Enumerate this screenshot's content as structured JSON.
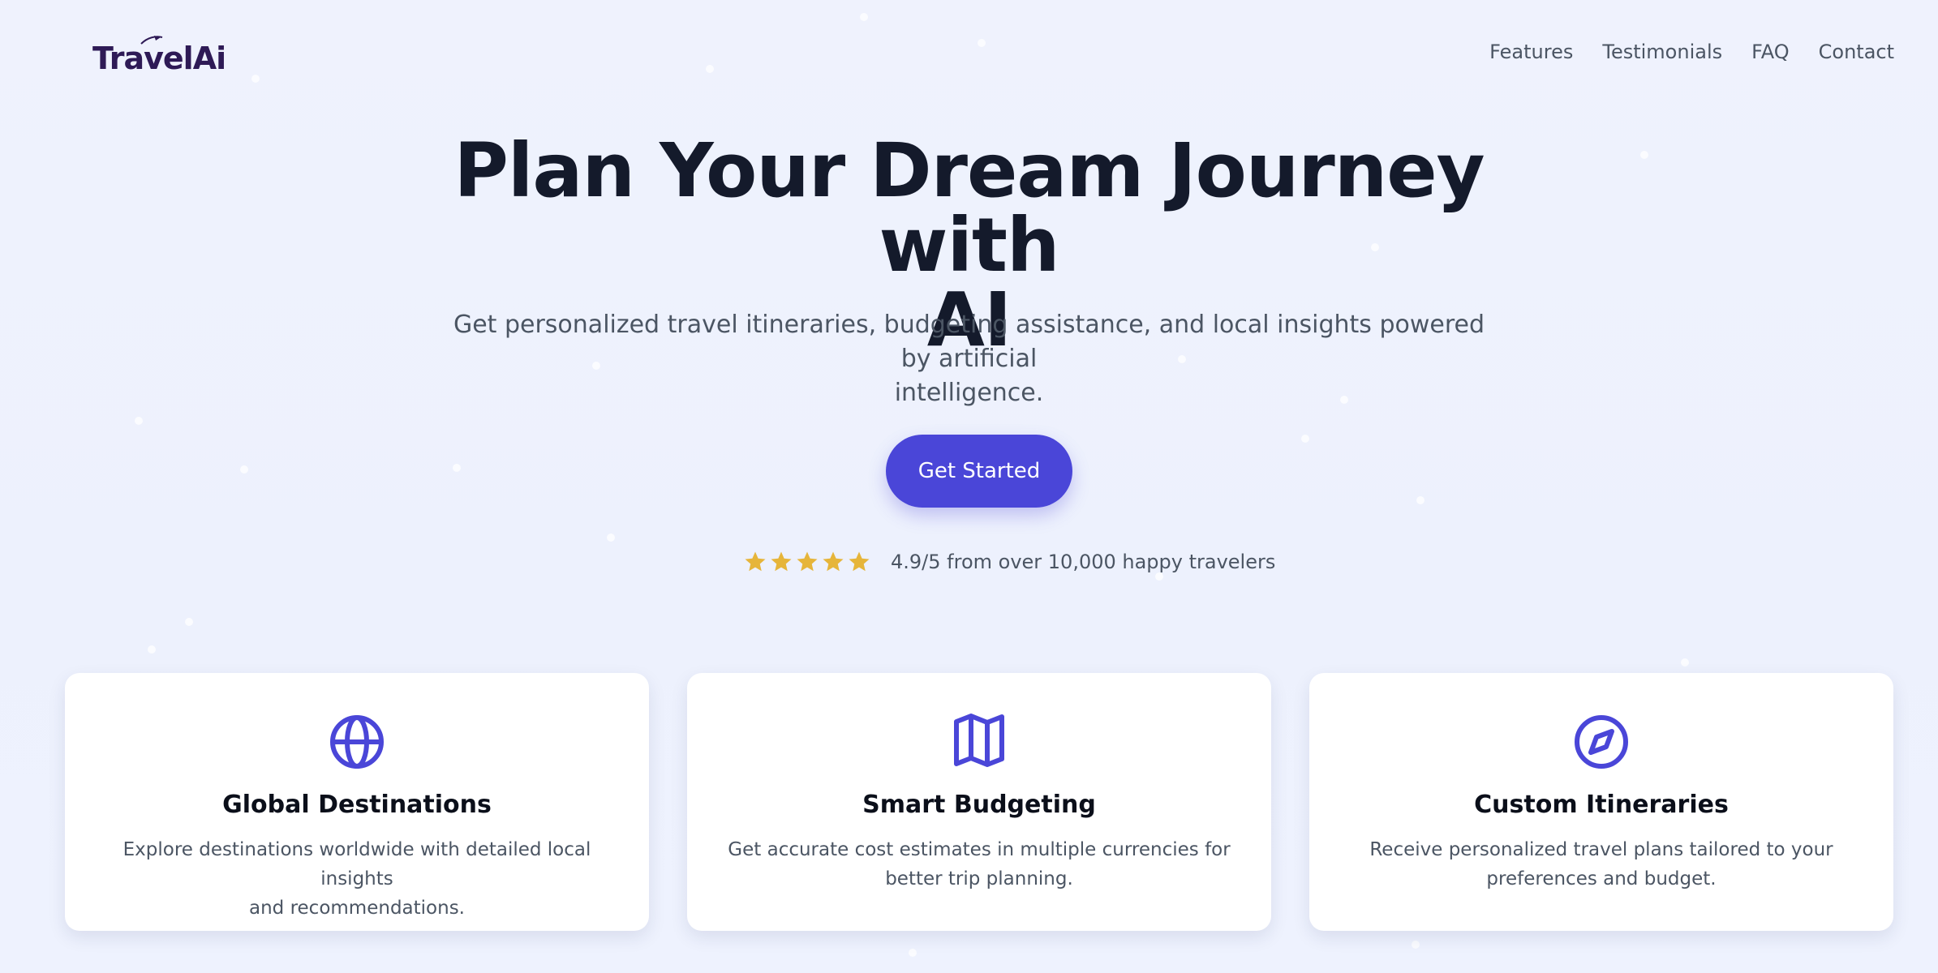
{
  "brand": {
    "logo_text": "TravelAi",
    "accent_color": "#4a46d8",
    "star_color": "#e6b53a",
    "title_color": "#141a2b"
  },
  "nav": {
    "items": [
      {
        "label": "Features"
      },
      {
        "label": "Testimonials"
      },
      {
        "label": "FAQ"
      },
      {
        "label": "Contact"
      }
    ]
  },
  "hero": {
    "title_line1": "Plan Your Dream Journey with",
    "title_line2": "AI",
    "subtitle_line1": "Get personalized travel itineraries, budgeting assistance, and local insights powered by artificial",
    "subtitle_line2": "intelligence.",
    "cta_label": "Get Started"
  },
  "rating": {
    "stars": 5,
    "stars_max": 5,
    "text": "4.9/5 from over 10,000 happy travelers"
  },
  "features": [
    {
      "icon": "globe-icon",
      "title": "Global Destinations",
      "desc_line1": "Explore destinations worldwide with detailed local insights",
      "desc_line2": "and recommendations."
    },
    {
      "icon": "map-icon",
      "title": "Smart Budgeting",
      "desc_line1": "Get accurate cost estimates in multiple currencies for",
      "desc_line2": "better trip planning."
    },
    {
      "icon": "compass-icon",
      "title": "Custom Itineraries",
      "desc_line1": "Receive personalized travel plans tailored to your",
      "desc_line2": "preferences and budget."
    }
  ]
}
